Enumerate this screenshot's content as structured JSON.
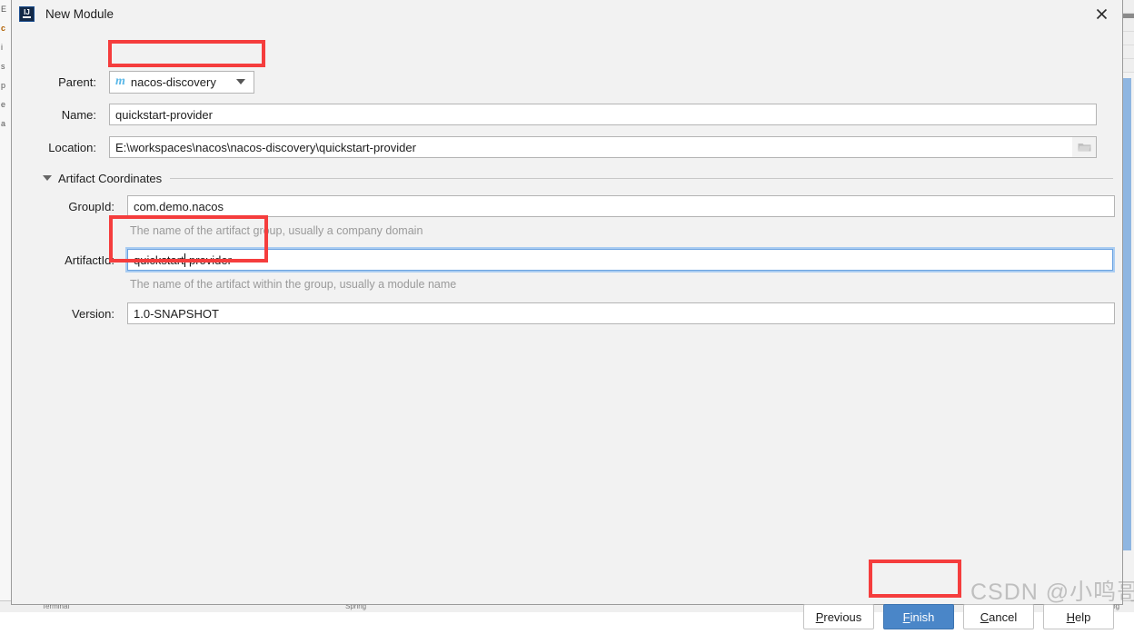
{
  "window": {
    "title": "New Module",
    "app_icon": "intellij-idea-icon",
    "close_icon": "close-icon"
  },
  "form": {
    "parent": {
      "label": "Parent:",
      "value": "nacos-discovery",
      "icon": "maven-module-icon",
      "dropdown_icon": "chevron-down-icon",
      "highlighted": true
    },
    "name": {
      "label": "Name:",
      "value": "quickstart-provider",
      "placeholder": ""
    },
    "location": {
      "label": "Location:",
      "value": "E:\\workspaces\\nacos\\nacos-discovery\\quickstart-provider",
      "placeholder": "",
      "browse_icon": "folder-icon"
    },
    "section": {
      "title": "Artifact Coordinates",
      "expanded": true,
      "toggle_icon": "triangle-down-icon"
    },
    "group_id": {
      "label": "GroupId:",
      "value": "com.demo.nacos",
      "hint": "The name of the artifact group, usually a company domain"
    },
    "artifact_id": {
      "label": "ArtifactId:",
      "value": "quickstart",
      "value_tail": "-provider",
      "hint": "The name of the artifact within the group, usually a module name",
      "focused": true,
      "highlighted": true
    },
    "version": {
      "label": "Version:",
      "value": "1.0-SNAPSHOT"
    }
  },
  "footer": {
    "previous": {
      "label_mnemonic": "P",
      "label_rest": "revious"
    },
    "finish": {
      "label_mnemonic": "F",
      "label_rest": "inish",
      "primary": true,
      "highlighted": true
    },
    "cancel": {
      "label_mnemonic": "C",
      "label_rest": "ancel"
    },
    "help": {
      "label_mnemonic": "H",
      "label_rest": "elp"
    }
  },
  "watermark": {
    "text": "CSDN @小鸣哥呀"
  },
  "colors": {
    "annotation_red": "#f53d3d",
    "primary_button": "#4a86c8",
    "focus_border": "#6aa2e0",
    "maven_icon": "#5bb8e8",
    "dialog_bg": "#f2f2f2"
  },
  "background_ide": {
    "left_fragments": [
      "E",
      "c",
      "i",
      "s",
      "",
      "",
      "p",
      "e",
      "a"
    ],
    "bottom_text_left": "Terminal",
    "bottom_text_mid": "Spring",
    "bottom_text_right": "Event Log"
  }
}
